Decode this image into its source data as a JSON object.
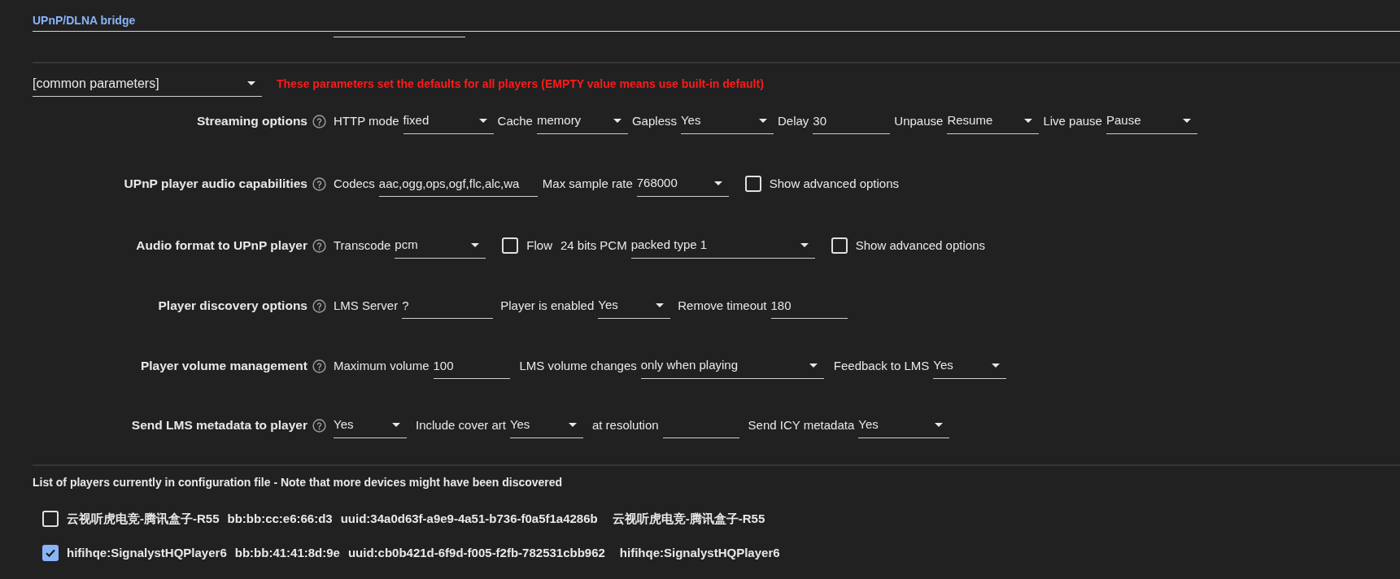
{
  "header": {
    "title": "UPnP/DLNA bridge"
  },
  "player_select": {
    "value": "[common parameters]",
    "note": "These parameters set the defaults for all players (EMPTY value means use built-in default)"
  },
  "sections": [
    {
      "label": "Streaming options",
      "controls": [
        {
          "kind": "select",
          "label": "HTTP mode",
          "value": "fixed"
        },
        {
          "kind": "select",
          "label": "Cache",
          "value": "memory"
        },
        {
          "kind": "select",
          "label": "Gapless",
          "value": "Yes"
        },
        {
          "kind": "input",
          "label": "Delay",
          "value": "30"
        },
        {
          "kind": "select",
          "label": "Unpause",
          "value": "Resume"
        },
        {
          "kind": "select",
          "label": "Live pause",
          "value": "Pause"
        }
      ]
    },
    {
      "label": "UPnP player audio capabilities",
      "controls": [
        {
          "kind": "input",
          "label": "Codecs",
          "value": "aac,ogg,ops,ogf,flc,alc,wa"
        },
        {
          "kind": "select",
          "label": "Max sample rate",
          "value": "768000"
        },
        {
          "kind": "checkbox",
          "label": "Show advanced options",
          "checked": false
        }
      ]
    },
    {
      "label": "Audio format to UPnP player",
      "controls": [
        {
          "kind": "select",
          "label": "Transcode",
          "value": "pcm"
        },
        {
          "kind": "checkbox",
          "label": "Flow",
          "checked": false
        },
        {
          "kind": "select",
          "label": "24 bits PCM",
          "value": "packed type 1"
        },
        {
          "kind": "checkbox",
          "label": "Show advanced options",
          "checked": false
        }
      ]
    },
    {
      "label": "Player discovery options",
      "controls": [
        {
          "kind": "input",
          "label": "LMS Server",
          "value": "?"
        },
        {
          "kind": "select",
          "label": "Player is enabled",
          "value": "Yes"
        },
        {
          "kind": "input",
          "label": "Remove timeout",
          "value": "180"
        }
      ]
    },
    {
      "label": "Player volume management",
      "controls": [
        {
          "kind": "input",
          "label": "Maximum volume",
          "value": "100"
        },
        {
          "kind": "select",
          "label": "LMS volume changes",
          "value": "only when playing"
        },
        {
          "kind": "select",
          "label": "Feedback to LMS",
          "value": "Yes"
        }
      ]
    },
    {
      "label": "Send LMS metadata to player",
      "controls": [
        {
          "kind": "select",
          "value": "Yes"
        },
        {
          "kind": "select",
          "label": "Include cover art",
          "value": "Yes"
        },
        {
          "kind": "input",
          "label": "at resolution"
        },
        {
          "kind": "select",
          "label": "Send ICY metadata",
          "value": "Yes"
        }
      ]
    }
  ],
  "players_list": {
    "title": "List of players currently in configuration file - Note that more devices might have been discovered",
    "players": [
      {
        "checked": false,
        "name": "云视听虎电竞-腾讯盒子-R55",
        "mac": "bb:bb:cc:e6:66:d3",
        "uuid": "uuid:34a0d63f-a9e9-4a51-b736-f0a5f1a4286b",
        "display_name": "云视听虎电竞-腾讯盒子-R55"
      },
      {
        "checked": true,
        "name": "hifihqe:SignalystHQPlayer6",
        "mac": "bb:bb:41:41:8d:9e",
        "uuid": "uuid:cb0b421d-6f9d-f005-f2fb-782531cbb962",
        "display_name": "hifihqe:SignalystHQPlayer6"
      }
    ]
  }
}
